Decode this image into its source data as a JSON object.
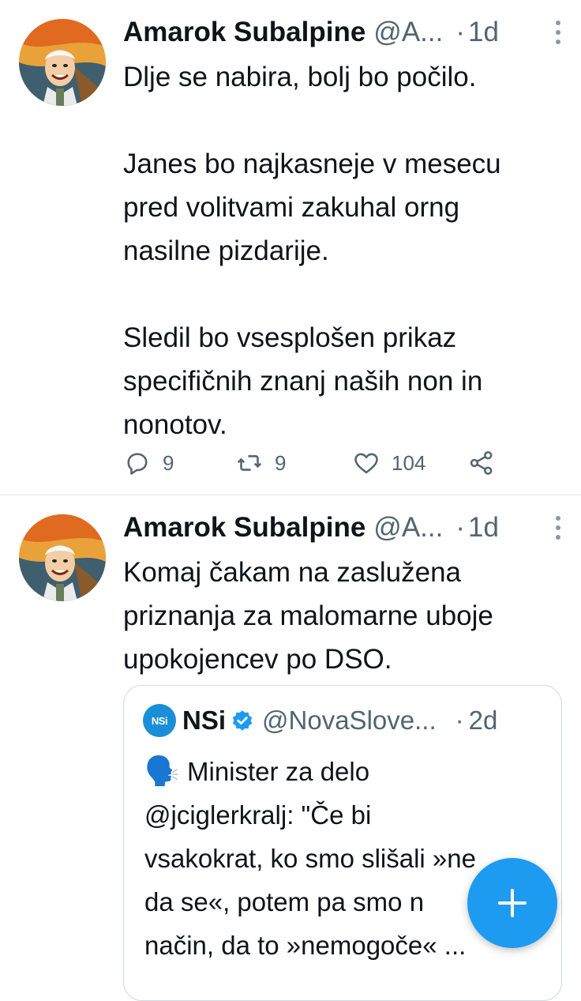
{
  "tweets": [
    {
      "name": "Amarok Subalpine",
      "handle": "@A...",
      "separator": "·",
      "time": "1d",
      "text": "Dlje se nabira, bolj bo počilo.\n\nJanes bo najkasneje v mesecu\npred volitvami zakuhal orng\nnasilne pizdarije.\n\nSledil bo vsesplošen prikaz\nspecifičnih znanj naših non in\nnonotov.",
      "actions": {
        "replies": "9",
        "retweets": "9",
        "likes": "104"
      }
    },
    {
      "name": "Amarok Subalpine",
      "handle": "@A...",
      "separator": "·",
      "time": "1d",
      "text": "Komaj čakam na zaslužena\npriznanja za malomarne uboje\nupokojencev po DSO.",
      "quote": {
        "logo_text": "NSi",
        "name": "NSi",
        "handle": "@NovaSlove...",
        "separator": "·",
        "time": "2d",
        "emoji": "🗣️",
        "text": " Minister za delo\n@jciglerkralj: \"Če bi\nvsakokrat, ko smo slišali »ne\nda se«, potem pa smo n\nnačin, da to »nemogoče« ..."
      }
    }
  ],
  "icons": {
    "reply": "reply-icon",
    "retweet": "retweet-icon",
    "like": "heart-icon",
    "share": "share-icon",
    "more": "more-vertical-icon",
    "verified": "verified-badge-icon",
    "compose": "plus-icon"
  },
  "colors": {
    "accent": "#1d9bf0",
    "text": "#0f1419",
    "secondary": "#536471",
    "border": "#cfd9de"
  }
}
